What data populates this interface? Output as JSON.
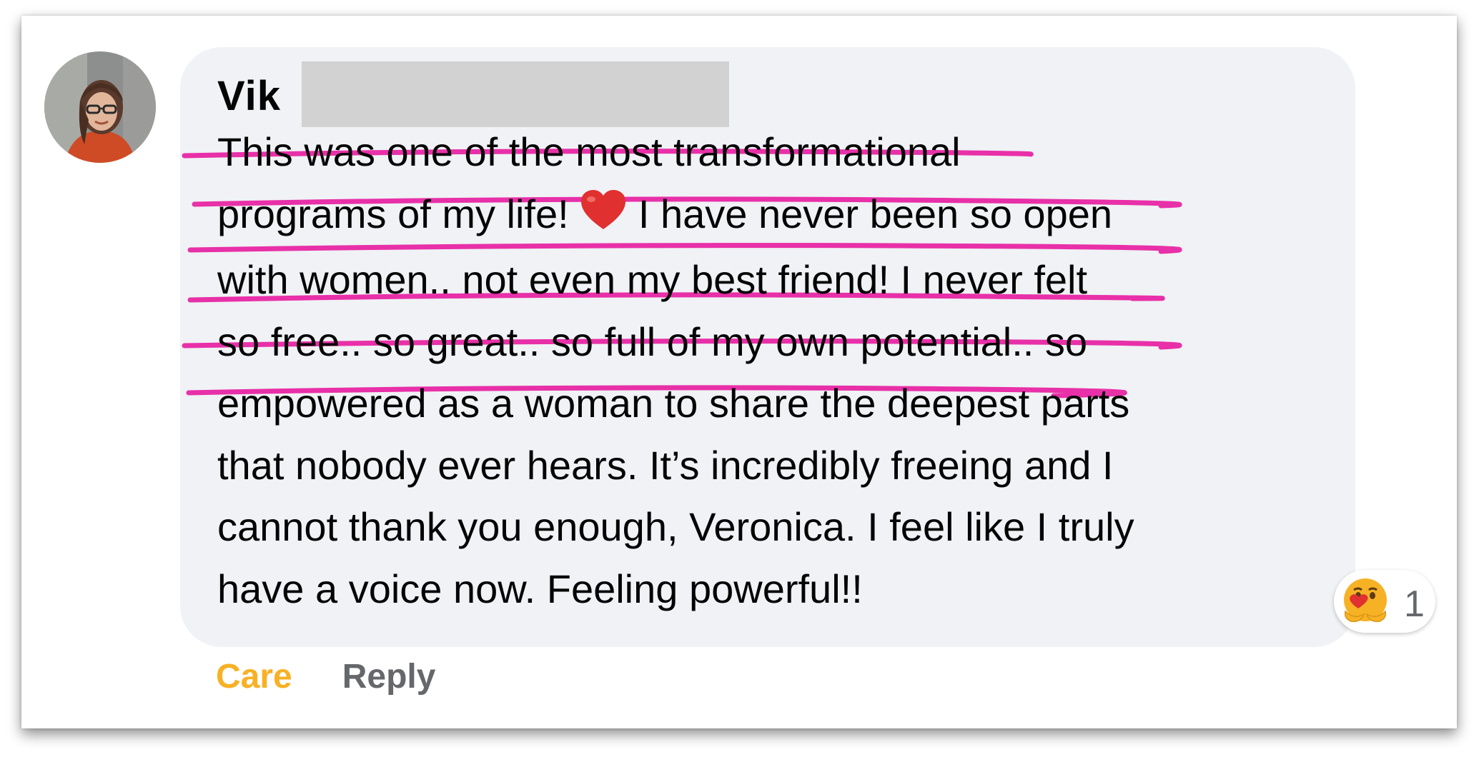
{
  "comment": {
    "author_name": "Vik",
    "lines": [
      "This was one of the most transformational",
      "programs of my life!",
      "I have never been so open",
      "with women.. not even my best friend! I never felt",
      "so free.. so great.. so full of my own potential.. so",
      "empowered as a woman to share the deepest parts",
      "that nobody ever hears. It’s incredibly freeing and I",
      "cannot thank you enough, Veronica. I feel like I truly",
      "have a voice now. Feeling powerful!!"
    ],
    "inline_emoji": "heart-emoji"
  },
  "reactions": {
    "icon": "care-emoji-icon",
    "count": "1"
  },
  "actions": {
    "care_label": "Care",
    "reply_label": "Reply"
  },
  "colors": {
    "highlight_underline": "#e830a8",
    "care_active": "#f7b125",
    "bubble_bg": "#f0f2f5",
    "muted_text": "#65676b"
  }
}
